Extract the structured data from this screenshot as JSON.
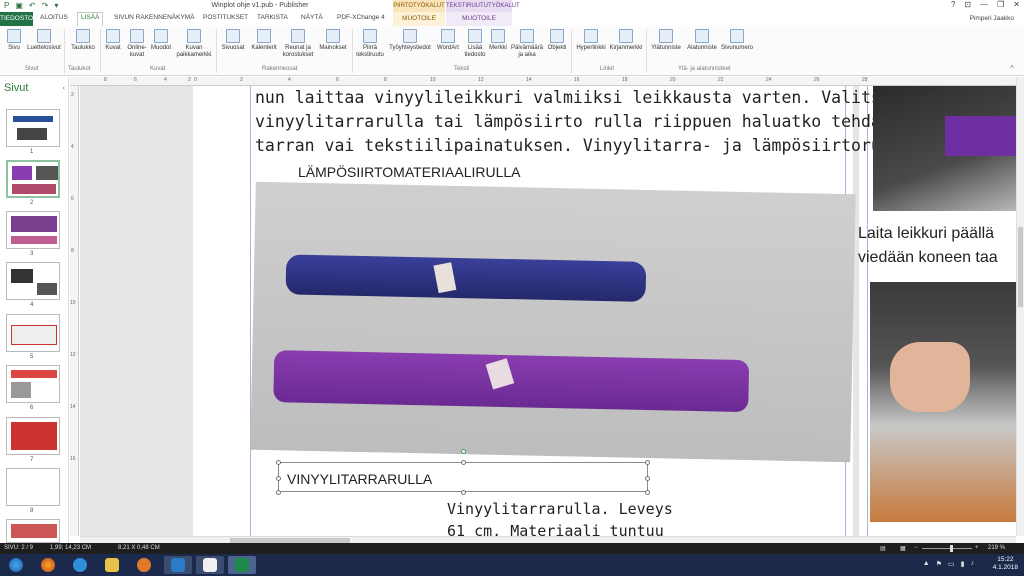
{
  "window": {
    "title": "Winplot ohje v1.pub - Publisher",
    "context_tab_piirto": "PIIRTOTYÖKALUT",
    "context_tab_teksti": "TEKSTIRUUTUTYÖKALUT",
    "controls": [
      "?",
      "⊡",
      "—",
      "❐",
      "✕"
    ]
  },
  "tabs": {
    "file": "TIEDOSTO",
    "items": [
      "ALOITUS",
      "LISÄÄ",
      "SIVUN RAKENNENÄKYMÄ",
      "POSTITUKSET",
      "TARKISTA",
      "NÄYTÄ",
      "PDF-XChange 4",
      "MUOTOILE",
      "MUOTOILE"
    ],
    "active": "LISÄÄ",
    "user": "Pimperi Jaakko"
  },
  "ribbon": {
    "buttons": [
      "Sivu",
      "Luettelosivut",
      "Taulukko",
      "Kuvat",
      "Online-kuvat",
      "Muodot",
      "Kuvan paikkamerkki",
      "Sivuosat",
      "Kalenterit",
      "Reunat ja korostukset",
      "Mainokset",
      "Piirrä tekstiruutu",
      "Työyhteystiedot",
      "WordArt",
      "Lisää tiedosto",
      "Merkki",
      "Päivämäärä ja aika",
      "Objekti",
      "Hyperlinkki",
      "Kirjanmerkki",
      "Ylätunniste",
      "Alatunniste",
      "Sivunumero"
    ],
    "groups": [
      "Sivut",
      "Taulukot",
      "Kuvat",
      "Rakenneosat",
      "Teksti",
      "Linkit",
      "Ylä- ja alatunnisteet"
    ]
  },
  "pages_panel": {
    "title": "Sivut",
    "pages": [
      "1",
      "2",
      "3",
      "4",
      "5",
      "6",
      "7",
      "8"
    ],
    "selected": "2"
  },
  "rulers": {
    "h": [
      "8",
      "6",
      "4",
      "2",
      "0",
      "2",
      "4",
      "6",
      "8",
      "10",
      "12",
      "14",
      "16",
      "18",
      "20",
      "22",
      "24",
      "26",
      "28"
    ],
    "v": [
      "2",
      "4",
      "6",
      "8",
      "10",
      "12",
      "14",
      "16"
    ]
  },
  "document": {
    "body_lines": [
      "nun laittaa vinyylileikkuri valmiiksi leikkausta varten. Valitse joko",
      "vinyylitarrarulla tai lämpösiirto rulla riippuen haluatko tehdä vinyyli-",
      "tarran vai tekstiilipainatuksen. Vinyylitarra- ja lämpösiirtorullan"
    ],
    "heading": "LÄMPÖSIIRTOMATERIAALIRULLA",
    "textbox": "VINYYLITARRARULLA",
    "caption_lines": [
      "Vinyylitarrarulla. Leveys",
      "61 cm. Materiaali tuntuu"
    ],
    "right_lines": [
      "Laita leikkuri päällä",
      "viedään koneen taa"
    ]
  },
  "statusbar": {
    "page": "SIVU: 2 / 9",
    "position": "1,99; 14,23 CM",
    "size": "8,21 X  0,48 CM",
    "zoom": "219 %"
  },
  "taskbar": {
    "time": "15:22",
    "date": "4.1.2018",
    "apps": [
      "start",
      "firefox",
      "ie",
      "explorer",
      "media",
      "lync",
      "media-player",
      "publisher"
    ]
  },
  "colors": {
    "accent": "#2e7d32",
    "file_tab": "#217346",
    "taskbar": "#1b2a4a"
  }
}
